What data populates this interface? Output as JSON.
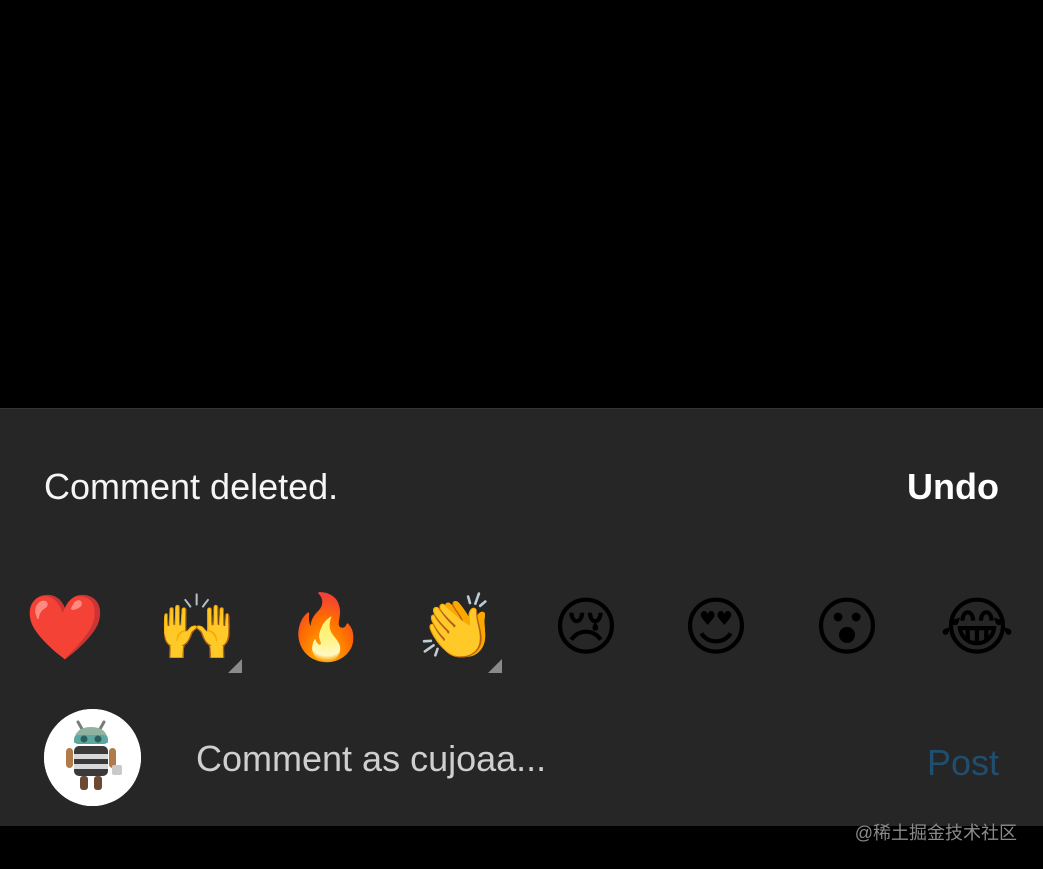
{
  "snackbar": {
    "message": "Comment deleted.",
    "action_label": "Undo"
  },
  "reactions": [
    {
      "name": "red-heart",
      "glyph": "❤️",
      "has_variants": false
    },
    {
      "name": "raising-hands",
      "glyph": "🙌",
      "has_variants": true
    },
    {
      "name": "fire",
      "glyph": "🔥",
      "has_variants": false
    },
    {
      "name": "clapping-hands",
      "glyph": "👏",
      "has_variants": true
    },
    {
      "name": "crying-face",
      "glyph": "😢",
      "has_variants": false
    },
    {
      "name": "heart-eyes",
      "glyph": "😍",
      "has_variants": false
    },
    {
      "name": "surprised-face",
      "glyph": "😮",
      "has_variants": false
    },
    {
      "name": "tears-of-joy",
      "glyph": "😂",
      "has_variants": false
    }
  ],
  "composer": {
    "avatar_icon": "android-robot-avatar",
    "placeholder": "Comment as cujoaa...",
    "value": "",
    "post_label": "Post"
  },
  "watermark": "@稀土掘金技术社区",
  "colors": {
    "background": "#000000",
    "sheet": "#262626",
    "post_disabled": "#1f4e6e"
  }
}
